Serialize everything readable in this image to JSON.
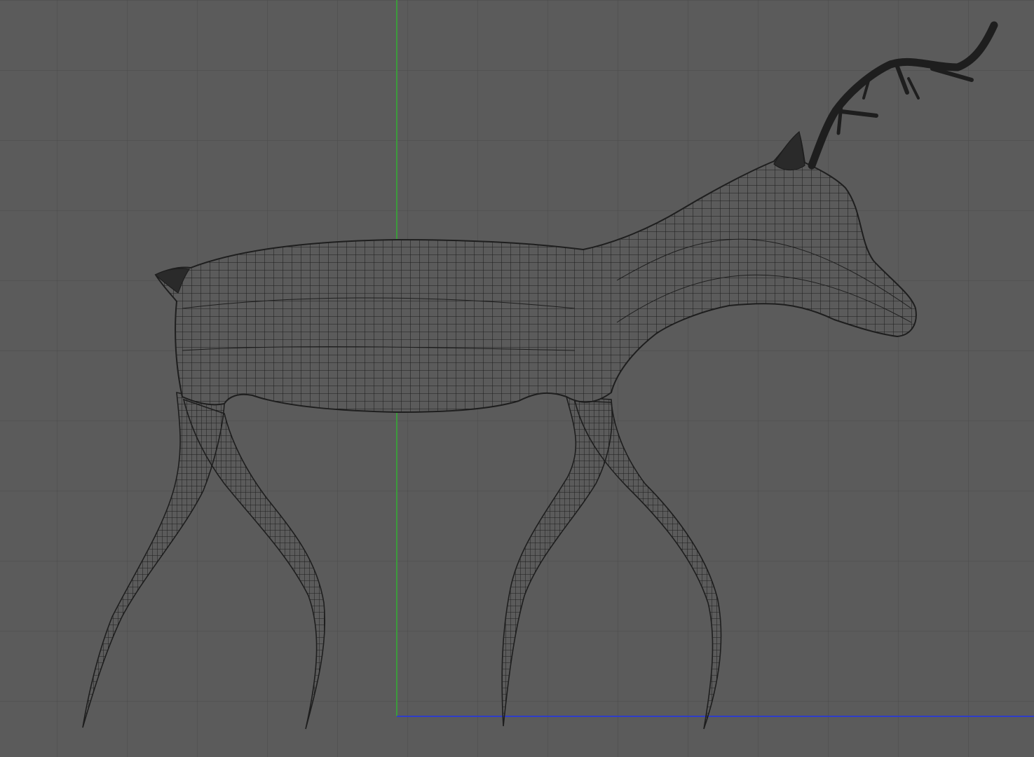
{
  "viewport": {
    "view": "orthographic-side",
    "display_mode": "wireframe",
    "background_color": "#5b5b5b",
    "grid_color": "#4b4b4b",
    "grid_visible": true,
    "y_axis_color": "#3c9a3c",
    "z_axis_color": "#2e3dc8",
    "mesh_color": "#1e1e1e",
    "model": {
      "subject": "deer",
      "parts": [
        "antler",
        "ear",
        "head",
        "neck",
        "body",
        "tail",
        "hind-leg-far",
        "hind-leg-near",
        "front-leg-far",
        "front-leg-near"
      ]
    }
  }
}
